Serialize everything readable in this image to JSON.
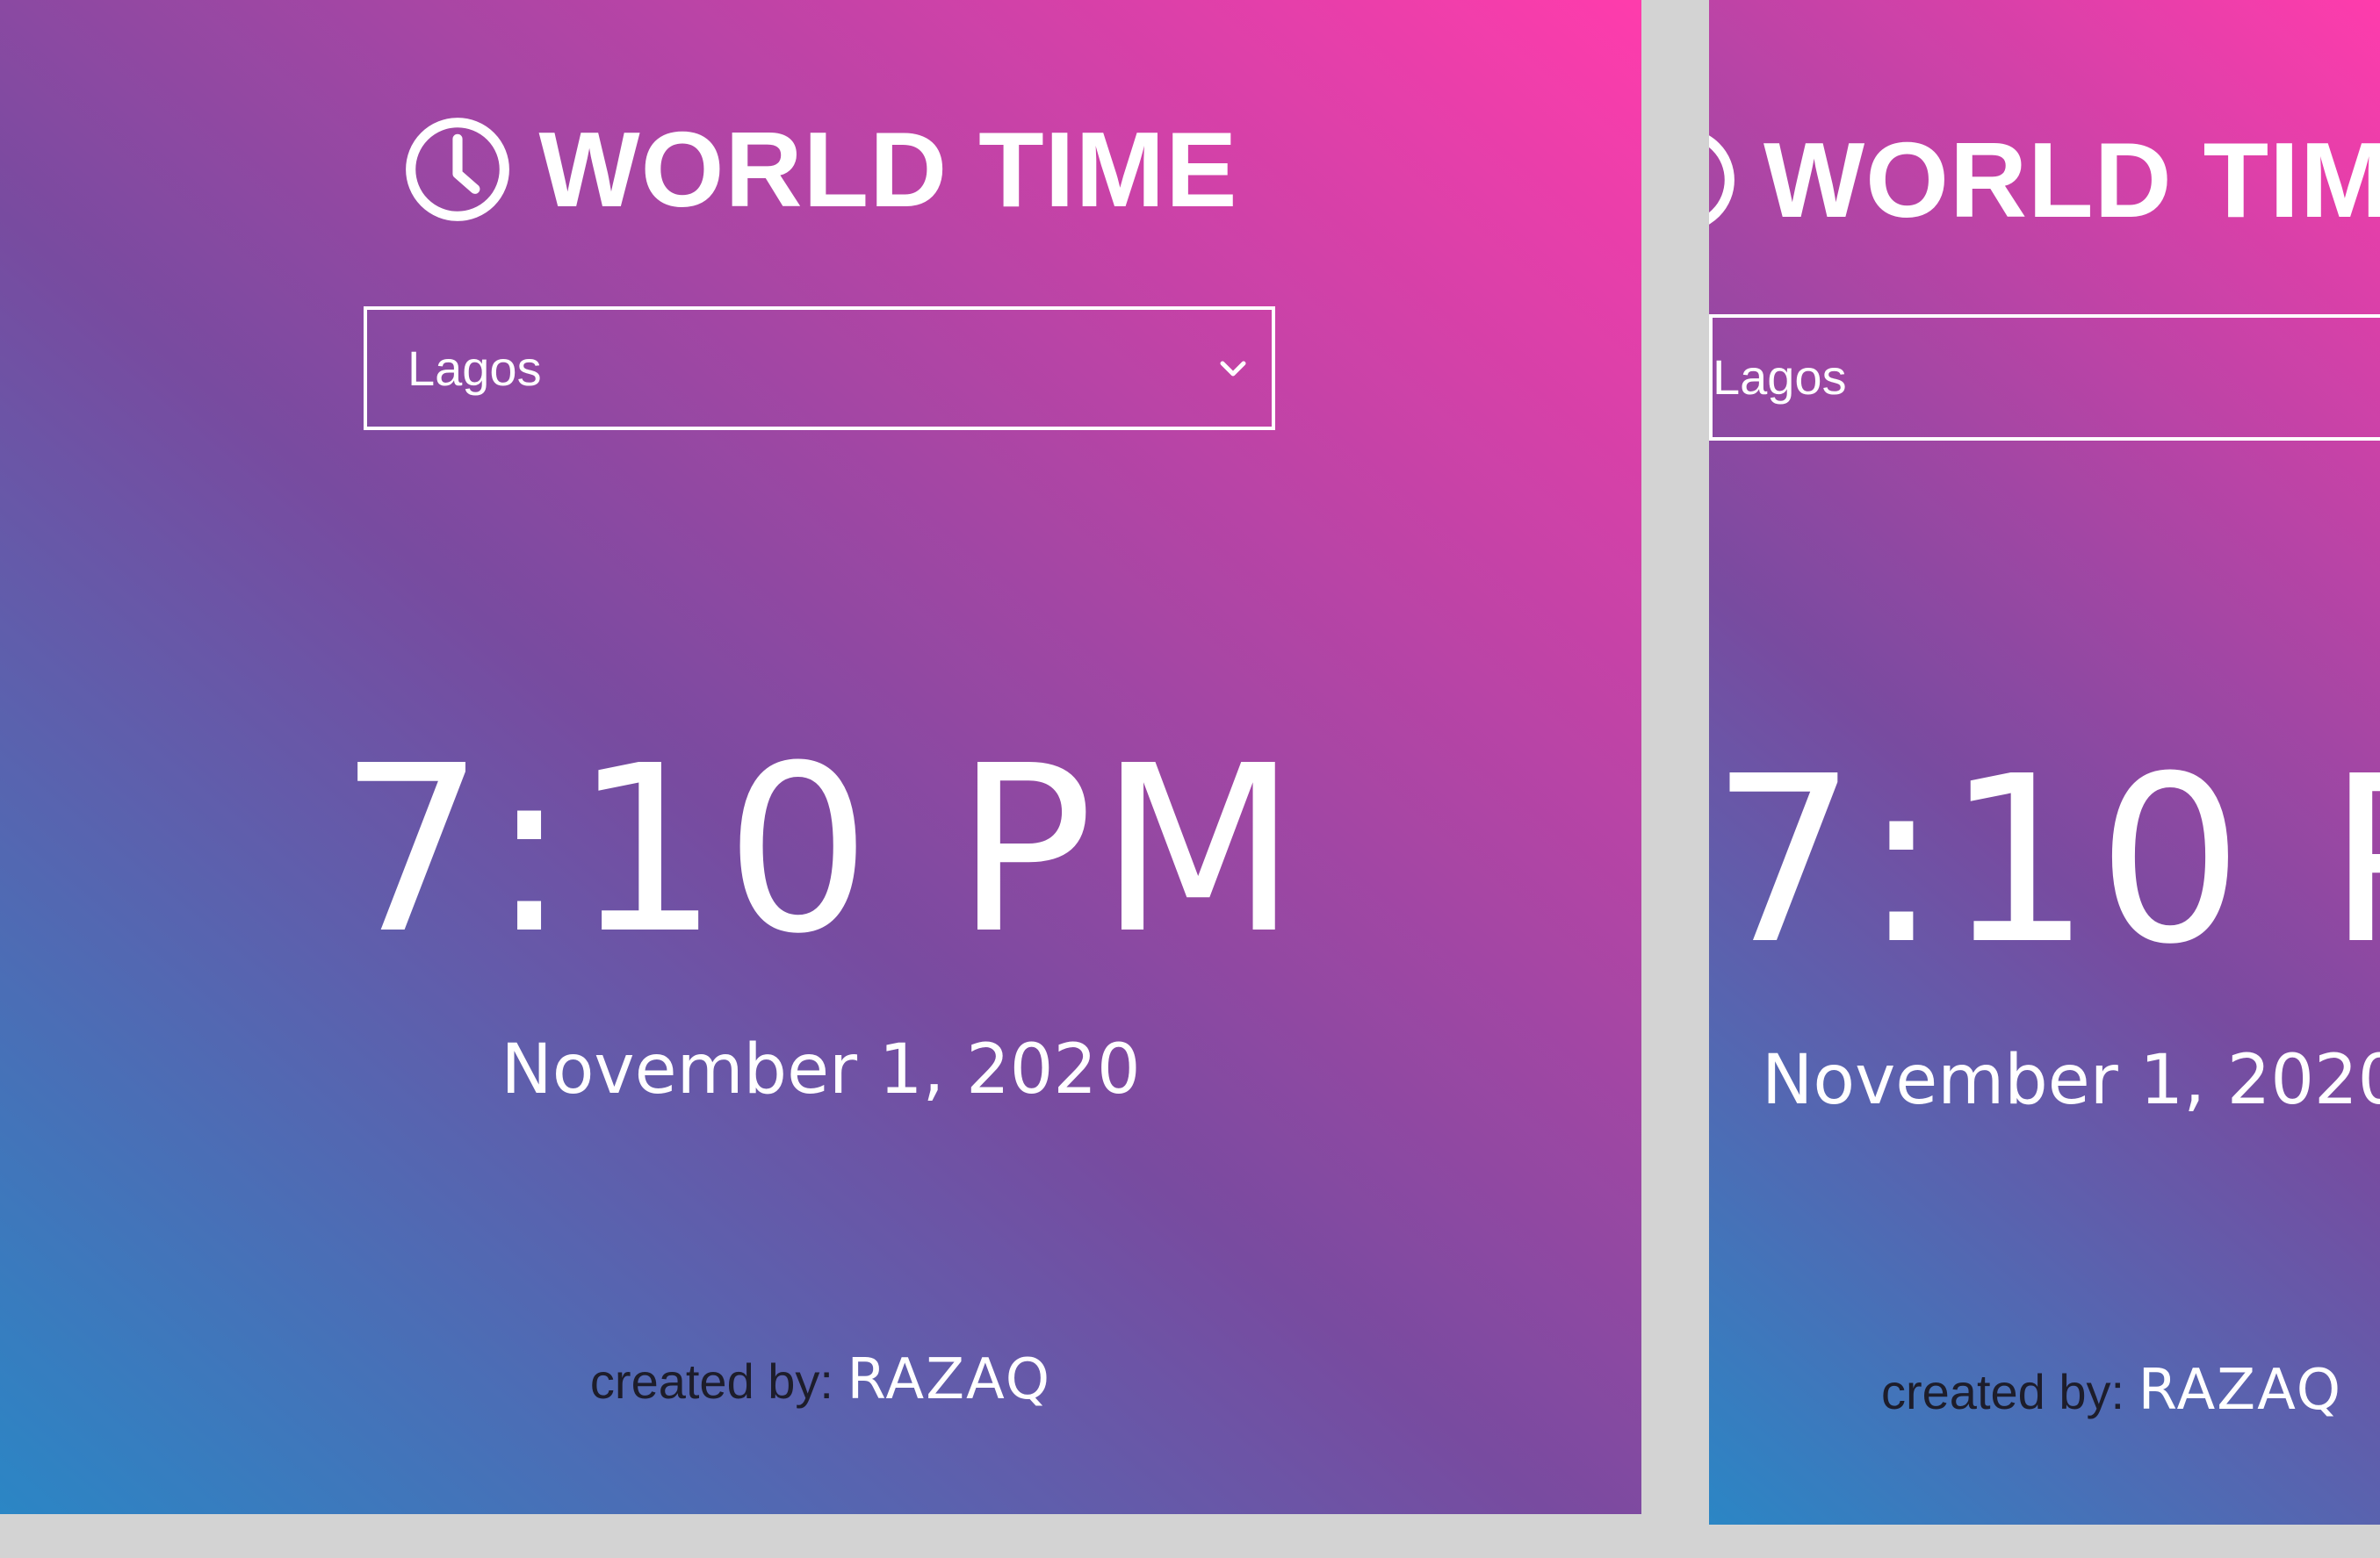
{
  "app": {
    "title": "WORLD TIME",
    "title_icon": "clock-icon"
  },
  "city_select": {
    "selected": "Lagos",
    "icon": "chevron-down-icon"
  },
  "clock": {
    "time": "7:10 PM",
    "date": "November 1, 2020"
  },
  "footer": {
    "label": "created by: ",
    "author": "RAZAQ"
  },
  "colors": {
    "page_background": "#d3d3d3",
    "gradient_start": "#2b86c5",
    "gradient_mid": "#784ba0",
    "gradient_end": "#ff3cac",
    "text": "#ffffff",
    "footer_label": "#1d1d2b"
  }
}
